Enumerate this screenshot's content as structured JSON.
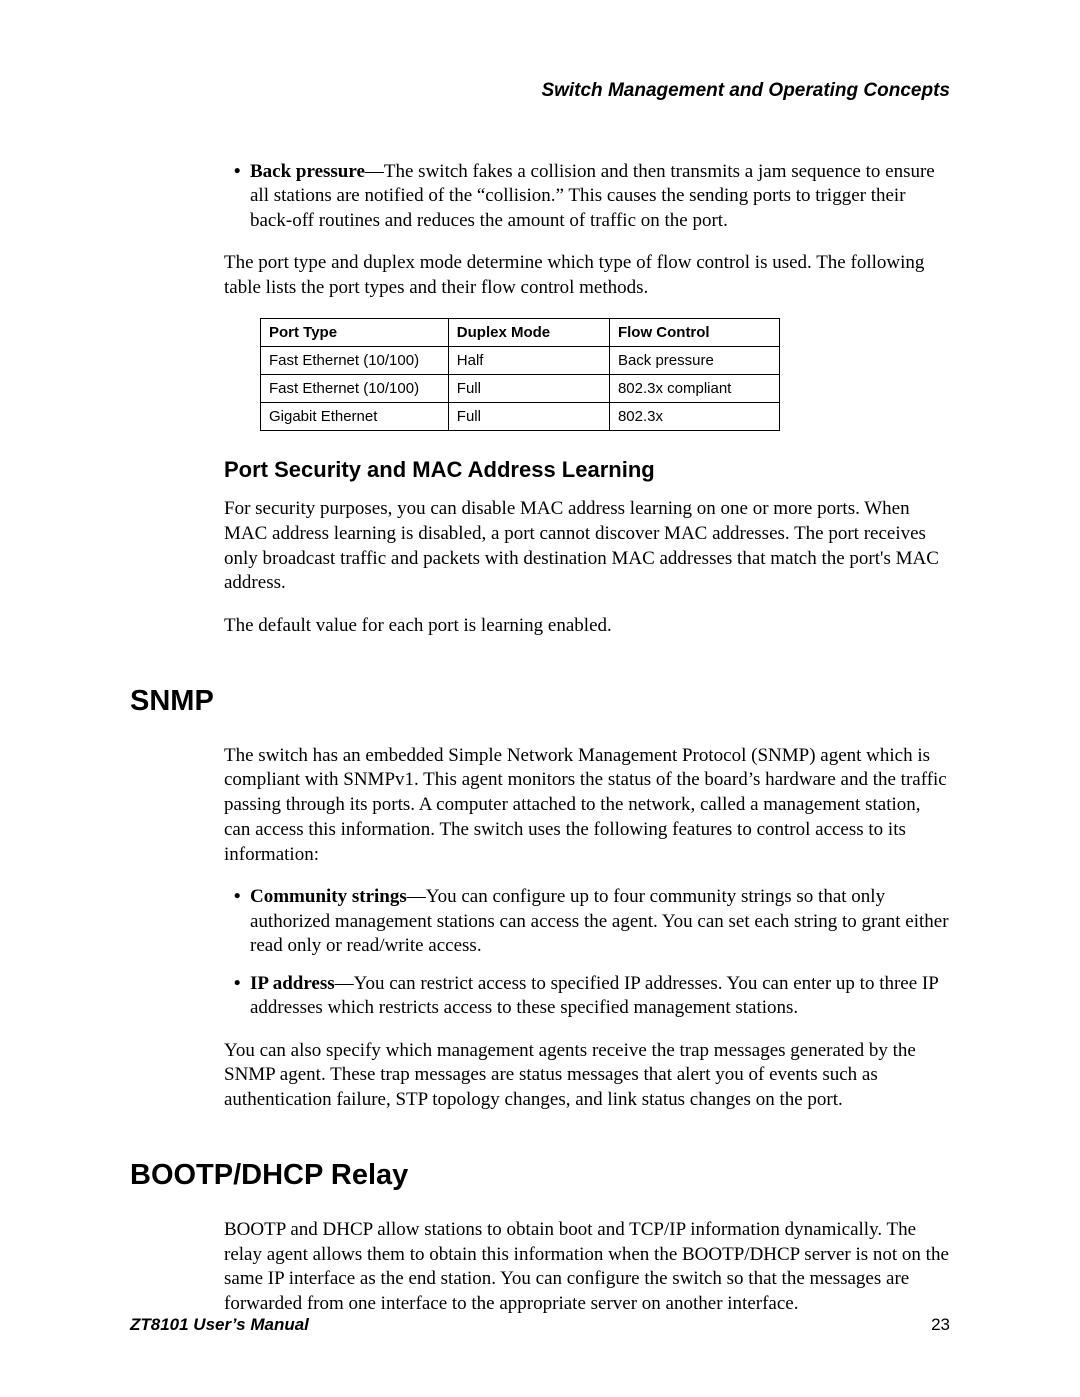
{
  "header": {
    "running_title": "Switch Management and Operating Concepts"
  },
  "back_pressure": {
    "term": "Back pressure",
    "text": "—The switch fakes a collision and then transmits a jam sequence to ensure all stations are notified of the “collision.” This causes the sending ports to trigger their back-off routines and reduces the amount of traffic on the port."
  },
  "flow_intro": "The port type and duplex mode determine which type of flow control is used. The following table lists the port types and their flow control methods.",
  "table": {
    "headers": {
      "c1": "Port Type",
      "c2": "Duplex Mode",
      "c3": "Flow Control"
    },
    "rows": [
      {
        "c1": "Fast Ethernet (10/100)",
        "c2": "Half",
        "c3": "Back pressure"
      },
      {
        "c1": "Fast Ethernet (10/100)",
        "c2": "Full",
        "c3": "802.3x compliant"
      },
      {
        "c1": "Gigabit Ethernet",
        "c2": "Full",
        "c3": "802.3x"
      }
    ]
  },
  "portsec": {
    "heading": "Port Security and MAC Address Learning",
    "p1": "For security purposes, you can disable MAC address learning on one or more ports. When MAC address learning is disabled, a port cannot discover MAC addresses. The port receives only broadcast traffic and packets with destination MAC addresses that match the port's MAC address.",
    "p2": "The default value for each port is learning enabled."
  },
  "snmp": {
    "heading": "SNMP",
    "p1": "The switch has an embedded Simple Network Management Protocol (SNMP) agent which is compliant with SNMPv1. This agent monitors the status of the board’s hardware and the traffic passing through its ports. A computer attached to the network, called a management station, can access this information. The switch uses the following features to control access to its information:",
    "bullets": [
      {
        "term": "Community strings",
        "text": "—You can configure up to four community strings so that only authorized management stations can access the agent. You can set each string to grant either read only or read/write access."
      },
      {
        "term": "IP address",
        "text": "—You can restrict access to specified IP addresses. You can enter up to three IP addresses which restricts access to these specified management stations."
      }
    ],
    "p2": "You can also specify which management agents receive the trap messages generated by the SNMP agent. These trap messages are status messages that alert you of events such as authentication failure, STP topology changes, and link status changes on the port."
  },
  "bootp": {
    "heading": "BOOTP/DHCP Relay",
    "p1": "BOOTP and DHCP allow stations to obtain boot and TCP/IP information dynamically. The relay agent allows them to obtain this information when the BOOTP/DHCP server is not on the same IP interface as the end station. You can configure the switch so that the messages are forwarded from one interface to the appropriate server on another interface."
  },
  "footer": {
    "manual": "ZT8101 User’s Manual",
    "page": "23"
  }
}
